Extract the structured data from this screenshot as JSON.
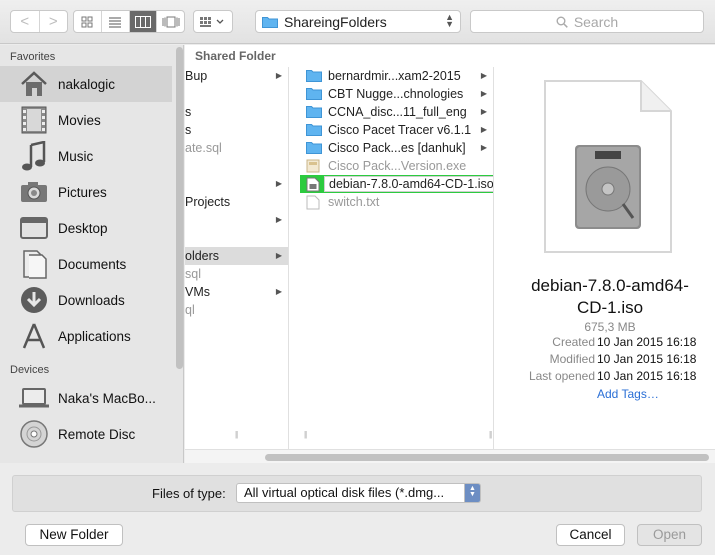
{
  "toolbar": {
    "back_glyph": "<",
    "forward_glyph": ">",
    "path_folder": "ShareingFolders",
    "search_placeholder": "Search"
  },
  "sidebar": {
    "favorites_header": "Favorites",
    "favorites": [
      {
        "label": "nakalogic",
        "icon": "home-icon",
        "selected": true
      },
      {
        "label": "Movies",
        "icon": "film-icon"
      },
      {
        "label": "Music",
        "icon": "music-icon"
      },
      {
        "label": "Pictures",
        "icon": "camera-icon"
      },
      {
        "label": "Desktop",
        "icon": "desktop-icon"
      },
      {
        "label": "Documents",
        "icon": "documents-icon"
      },
      {
        "label": "Downloads",
        "icon": "downloads-icon"
      },
      {
        "label": "Applications",
        "icon": "applications-icon"
      }
    ],
    "devices_header": "Devices",
    "devices": [
      {
        "label": "Naka's MacBo...",
        "icon": "laptop-icon"
      },
      {
        "label": "Remote Disc",
        "icon": "disc-icon"
      }
    ]
  },
  "browser": {
    "shared_header": "Shared Folder",
    "column1": [
      {
        "label": "Bup",
        "arrow": true
      },
      {
        "label": "s",
        "arrow": false
      },
      {
        "label": "s",
        "arrow": false
      },
      {
        "label": "ate.sql",
        "arrow": false,
        "dim": true
      },
      {
        "label": "",
        "arrow": true
      },
      {
        "label": "Projects",
        "arrow": false
      },
      {
        "label": "",
        "arrow": true
      },
      {
        "label": "",
        "arrow": false
      },
      {
        "label": "olders",
        "arrow": true,
        "selected": true
      },
      {
        "label": "sql",
        "arrow": false,
        "dim": true
      },
      {
        "label": "VMs",
        "arrow": true
      },
      {
        "label": "ql",
        "arrow": false,
        "dim": true
      }
    ],
    "column2": [
      {
        "label": "bernardmir...xam2-2015",
        "type": "folder",
        "arrow": true
      },
      {
        "label": "CBT Nugge...chnologies",
        "type": "folder",
        "arrow": true
      },
      {
        "label": "CCNA_disc...11_full_eng",
        "type": "folder",
        "arrow": true
      },
      {
        "label": "Cisco Pacet Tracer v6.1.1",
        "type": "folder",
        "arrow": true
      },
      {
        "label": "Cisco Pack...es [danhuk]",
        "type": "folder",
        "arrow": true
      },
      {
        "label": "Cisco Pack...Version.exe",
        "type": "exe",
        "dim": true
      },
      {
        "label": "debian-7.8.0-amd64-CD-1.iso",
        "type": "iso",
        "selected": true
      },
      {
        "label": "switch.txt",
        "type": "txt",
        "dim": true
      }
    ]
  },
  "preview": {
    "name_line1": "debian-7.8.0-amd64-",
    "name_line2": "CD-1.iso",
    "size": "675,3 MB",
    "created_label": "Created",
    "created_value": "10 Jan 2015 16:18",
    "modified_label": "Modified",
    "modified_value": "10 Jan 2015 16:18",
    "last_opened_label": "Last opened",
    "last_opened_value": "10 Jan 2015 16:18",
    "add_tags": "Add Tags…"
  },
  "bottom": {
    "files_of_type_label": "Files of type:",
    "files_of_type_value": "All virtual optical disk files (*.dmg...",
    "new_folder": "New Folder",
    "cancel": "Cancel",
    "open": "Open"
  },
  "colors": {
    "selection_green": "#2ccb3f",
    "folder_blue": "#5fb4f0",
    "link_blue": "#2a6fd6"
  }
}
